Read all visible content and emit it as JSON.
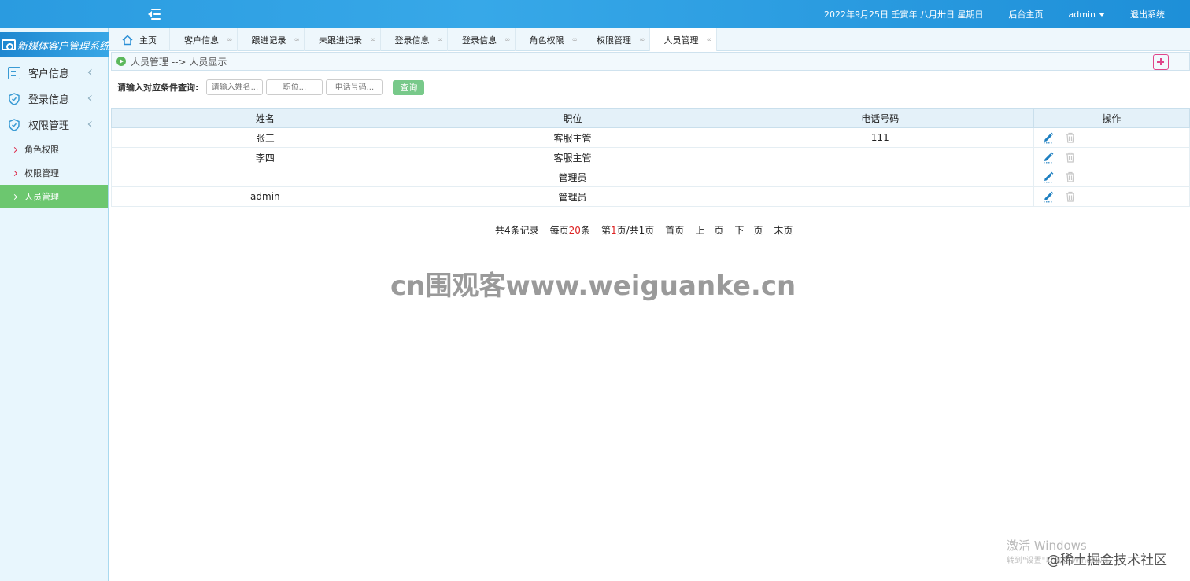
{
  "topbar": {
    "date": "2022年9月25日 壬寅年 八月卅日 星期日",
    "home_link": "后台主页",
    "user": "admin",
    "logout": "退出系统"
  },
  "sidebar": {
    "brand": "新媒体客户管理系统",
    "items": [
      {
        "label": "客户信息",
        "icon": "document-icon"
      },
      {
        "label": "登录信息",
        "icon": "shield-icon"
      },
      {
        "label": "权限管理",
        "icon": "shield-icon"
      }
    ],
    "sub_items": [
      {
        "label": "角色权限"
      },
      {
        "label": "权限管理"
      },
      {
        "label": "人员管理",
        "active": true
      }
    ]
  },
  "tabs": [
    {
      "label": "主页"
    },
    {
      "label": "客户信息",
      "close": "∞"
    },
    {
      "label": "跟进记录",
      "close": "∞"
    },
    {
      "label": "未跟进记录",
      "close": "∞"
    },
    {
      "label": "登录信息",
      "close": "∞"
    },
    {
      "label": "登录信息",
      "close": "∞"
    },
    {
      "label": "角色权限",
      "close": "∞"
    },
    {
      "label": "权限管理",
      "close": "∞"
    },
    {
      "label": "人员管理",
      "close": "∞",
      "active": true
    }
  ],
  "breadcrumb": {
    "text": "人员管理 --> 人员显示"
  },
  "search": {
    "label": "请输入对应条件查询:",
    "name_placeholder": "请输入姓名...",
    "position_placeholder": "职位...",
    "phone_placeholder": "电话号码...",
    "button": "查询"
  },
  "table": {
    "headers": [
      "姓名",
      "职位",
      "电话号码",
      "操作"
    ],
    "rows": [
      {
        "name": "张三",
        "position": "客服主管",
        "phone": "111"
      },
      {
        "name": "李四",
        "position": "客服主管",
        "phone": ""
      },
      {
        "name": "",
        "position": "管理员",
        "phone": ""
      },
      {
        "name": "admin",
        "position": "管理员",
        "phone": ""
      }
    ]
  },
  "pager": {
    "total_prefix": "共4条记录",
    "per_page_prefix": "每页",
    "per_page": "20",
    "per_page_suffix": "条",
    "page_prefix": "第",
    "page": "1",
    "page_suffix": "页/共1页",
    "first": "首页",
    "prev": "上一页",
    "next": "下一页",
    "last": "末页"
  },
  "overlay": {
    "watermark": "cn围观客www.weiguanke.cn",
    "windows_activate": "激活 Windows",
    "windows_sub": "转到\"设置\"以激活 Windows。",
    "juejin": "@稀土掘金技术社区"
  },
  "colors": {
    "topbar": "#2a9be0",
    "sidebar_bg": "#e8f6fd",
    "active_green": "#6cc76f",
    "search_button": "#78c98a",
    "add_button": "#e0468a",
    "edit_icon": "#1e7fc0"
  }
}
